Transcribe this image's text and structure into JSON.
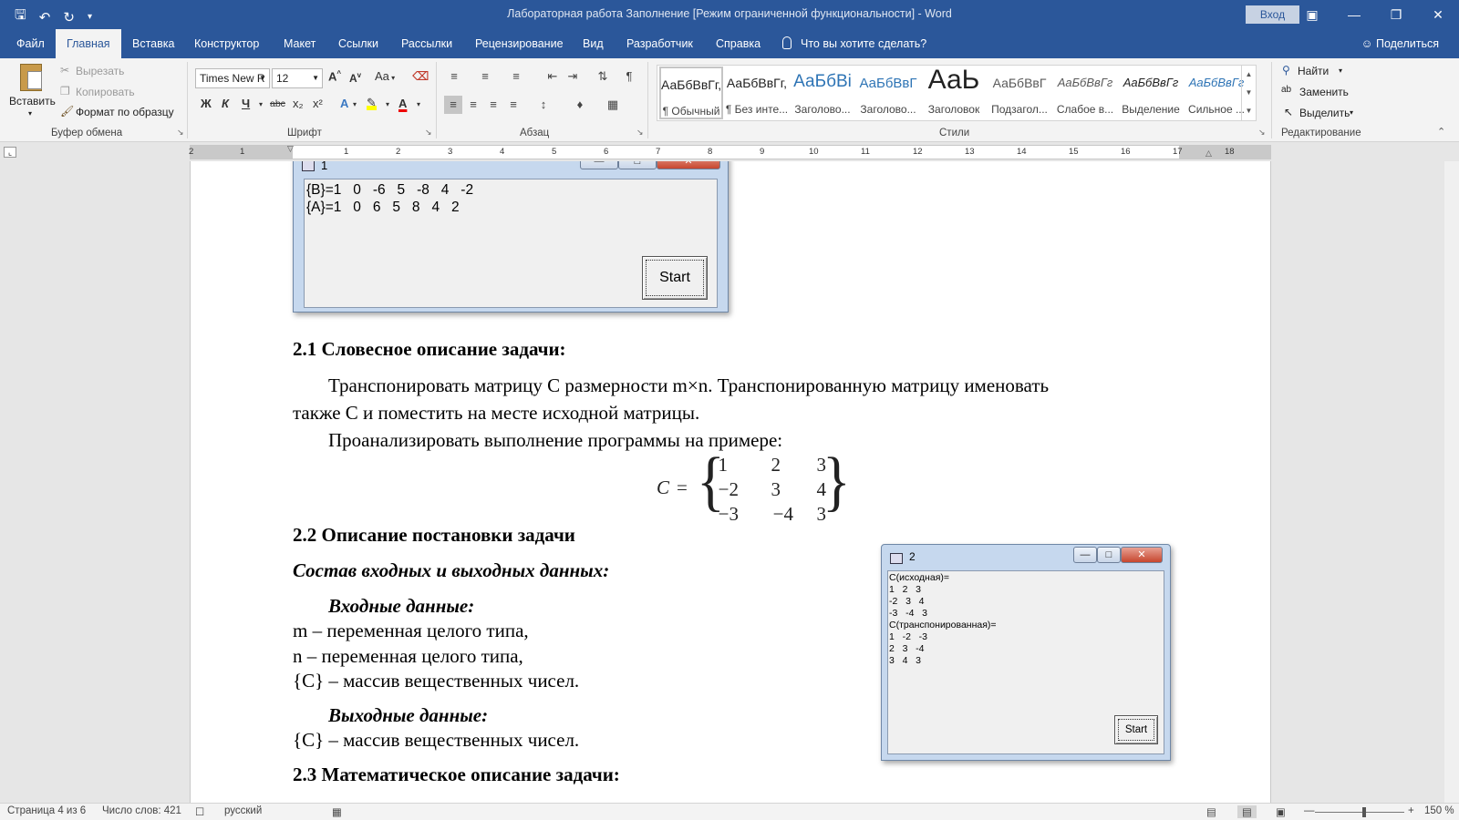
{
  "window": {
    "title": "Лабораторная работа Заполнение [Режим ограниченной функциональности]  -  Word",
    "signin": "Вход"
  },
  "qat": {
    "save_icon": "save-icon",
    "undo_icon": "undo-icon",
    "redo_icon": "redo-icon"
  },
  "tabs": [
    {
      "label": "Файл"
    },
    {
      "label": "Главная"
    },
    {
      "label": "Вставка"
    },
    {
      "label": "Конструктор"
    },
    {
      "label": "Макет"
    },
    {
      "label": "Ссылки"
    },
    {
      "label": "Рассылки"
    },
    {
      "label": "Рецензирование"
    },
    {
      "label": "Вид"
    },
    {
      "label": "Разработчик"
    },
    {
      "label": "Справка"
    }
  ],
  "tellme": "Что вы хотите сделать?",
  "share": "Поделиться",
  "clipboard": {
    "paste": "Вставить",
    "cut": "Вырезать",
    "copy": "Копировать",
    "format_painter": "Формат по образцу",
    "group": "Буфер обмена"
  },
  "font": {
    "name": "Times New R",
    "size": "12",
    "group": "Шрифт",
    "bold": "Ж",
    "italic": "К",
    "underline": "Ч",
    "strike": "abc",
    "sub": "x₂",
    "sup": "x²",
    "change_case": "Aa"
  },
  "paragraph": {
    "group": "Абзац"
  },
  "styles": {
    "group": "Стили",
    "items": [
      {
        "sample": "АаБбВвГг,",
        "name": "¶ Обычный"
      },
      {
        "sample": "АаБбВвГг,",
        "name": "¶ Без инте..."
      },
      {
        "sample": "АаБбВі",
        "name": "Заголово..."
      },
      {
        "sample": "АаБбВвГ",
        "name": "Заголово..."
      },
      {
        "sample": "АаЬ",
        "name": "Заголовок"
      },
      {
        "sample": "АаБбВвГ",
        "name": "Подзагол..."
      },
      {
        "sample": "АаБбВвГг",
        "name": "Слабое в..."
      },
      {
        "sample": "АаБбВвГг",
        "name": "Выделение"
      },
      {
        "sample": "АаБбВвГг",
        "name": "Сильное ..."
      }
    ]
  },
  "editing": {
    "find": "Найти",
    "replace": "Заменить",
    "select": "Выделить",
    "group": "Редактирование"
  },
  "ruler": {
    "numbers": [
      "2",
      "1",
      "1",
      "2",
      "3",
      "4",
      "5",
      "6",
      "7",
      "8",
      "9",
      "10",
      "11",
      "12",
      "13",
      "14",
      "15",
      "16",
      "17",
      "18"
    ]
  },
  "window1": {
    "title": "1",
    "output": "{B}=1   0   -6   5   -8   4   -2\n{A}=1   0   6   5   8   4   2",
    "button": "Start"
  },
  "window2": {
    "title": "2",
    "output": "С(исходная)=\n1   2   3\n-2   3   4\n-3   -4   3\nС(транспонированная)=\n1   -2   -3\n2   3   -4\n3   4   3",
    "button": "Start"
  },
  "document": {
    "h21": "2.1 Словесное описание задачи:",
    "p1a": "Транспонировать матрицу C размерности m×n. Транспонированную матрицу именовать",
    "p1b": "также C и поместить на месте исходной матрицы.",
    "p2": "Проанализировать выполнение программы на примере:",
    "matrix_label": "C",
    "matrix_eq": "=",
    "matrix": [
      [
        "1",
        "2",
        "3"
      ],
      [
        "−2",
        "3",
        "4"
      ],
      [
        "−3",
        "−4",
        "3"
      ]
    ],
    "h22": "2.2  Описание постановки задачи",
    "sub1": "Состав входных и выходных данных:",
    "input_h": "Входные данные:",
    "in1": "m – переменная целого типа,",
    "in2": "n – переменная целого типа,",
    "in3": "{C} – массив вещественных чисел.",
    "output_h": "Выходные данные:",
    "out1": "{C} – массив вещественных чисел.",
    "h23": "2.3 Математическое описание задачи:"
  },
  "status": {
    "page": "Страница 4 из 6",
    "words": "Число слов: 421",
    "lang": "русский",
    "zoom": "150 %"
  }
}
